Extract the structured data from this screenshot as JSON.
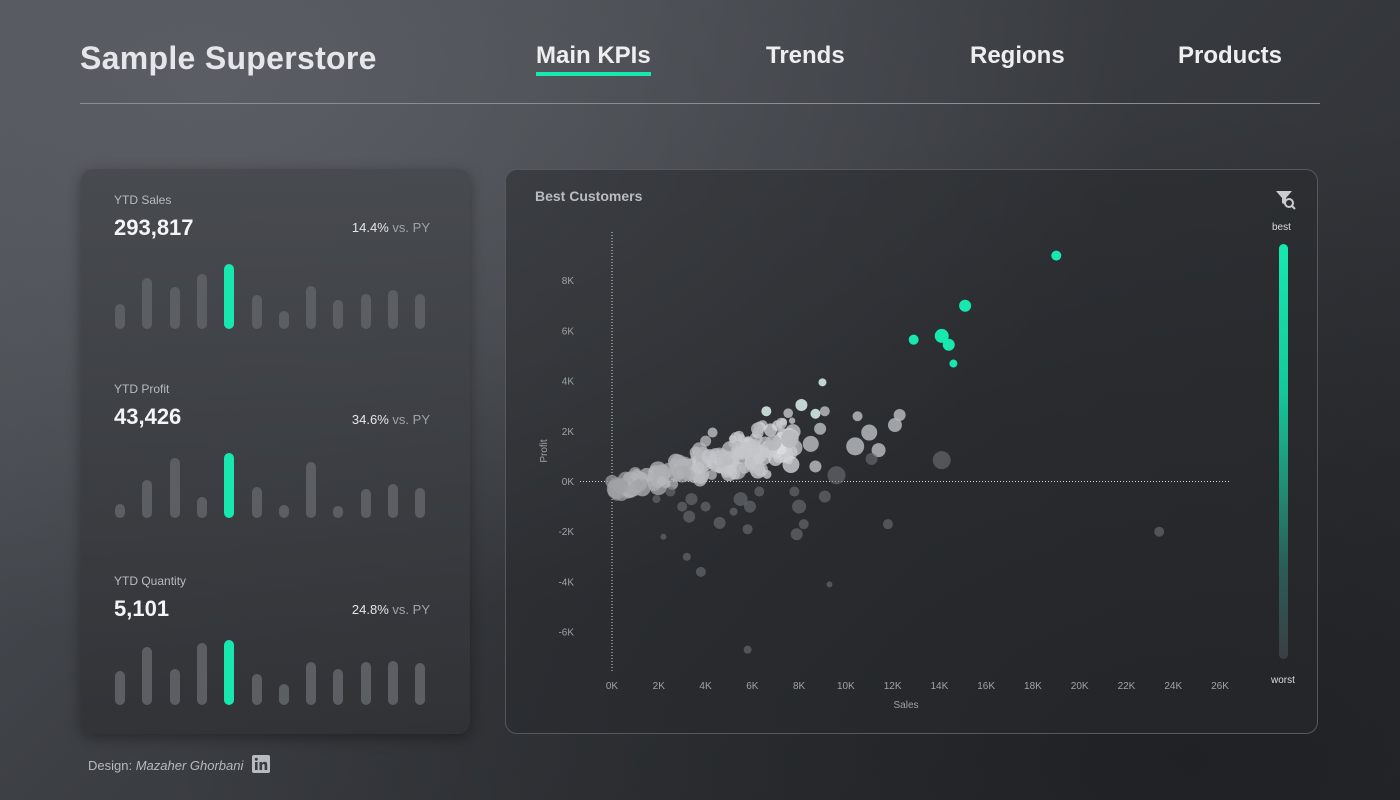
{
  "header": {
    "title": "Sample Superstore",
    "tabs": [
      {
        "label": "Main KPIs",
        "active": true
      },
      {
        "label": "Trends",
        "active": false
      },
      {
        "label": "Regions",
        "active": false
      },
      {
        "label": "Products",
        "active": false
      }
    ]
  },
  "colors": {
    "accent": "#17e8b0",
    "bar": "#5b5e63"
  },
  "kpis": [
    {
      "label": "YTD Sales",
      "value": "293,817",
      "change": "14.4%",
      "vs": "vs. PY",
      "spark": [
        0.38,
        0.78,
        0.65,
        0.85,
        1.0,
        0.52,
        0.28,
        0.66,
        0.45,
        0.54,
        0.6,
        0.54
      ],
      "highlight": 4
    },
    {
      "label": "YTD Profit",
      "value": "43,426",
      "change": "34.6%",
      "vs": "vs. PY",
      "spark": [
        0.22,
        0.58,
        0.92,
        0.33,
        1.0,
        0.48,
        0.2,
        0.86,
        0.16,
        0.44,
        0.52,
        0.46
      ],
      "highlight": 4
    },
    {
      "label": "YTD Quantity",
      "value": "5,101",
      "change": "24.8%",
      "vs": "vs. PY",
      "spark": [
        0.52,
        0.9,
        0.56,
        0.95,
        1.0,
        0.48,
        0.32,
        0.66,
        0.55,
        0.66,
        0.68,
        0.64
      ],
      "highlight": 4
    }
  ],
  "chart": {
    "title": "Best Customers",
    "filter_icon": "filter-search-icon",
    "legend_best": "best",
    "legend_worst": "worst"
  },
  "chart_data": {
    "type": "scatter",
    "title": "Best Customers",
    "xlabel": "Sales",
    "ylabel": "Profit",
    "xlim": [
      0,
      26000
    ],
    "ylim": [
      -7000,
      9000
    ],
    "xticks": [
      "0K",
      "2K",
      "4K",
      "6K",
      "8K",
      "10K",
      "12K",
      "14K",
      "16K",
      "18K",
      "20K",
      "22K",
      "24K",
      "26K"
    ],
    "xtick_values": [
      0,
      2000,
      4000,
      6000,
      8000,
      10000,
      12000,
      14000,
      16000,
      18000,
      20000,
      22000,
      24000,
      26000
    ],
    "yticks": [
      "8K",
      "6K",
      "4K",
      "2K",
      "0K",
      "-2K",
      "-4K",
      "-6K"
    ],
    "ytick_values": [
      8000,
      6000,
      4000,
      2000,
      0,
      -2000,
      -4000,
      -6000
    ],
    "color_legend": {
      "high": "best",
      "low": "worst"
    },
    "points": [
      {
        "x": 19000,
        "y": 9000,
        "r": 5,
        "c": "best"
      },
      {
        "x": 15100,
        "y": 7000,
        "r": 6,
        "c": "best"
      },
      {
        "x": 12900,
        "y": 5650,
        "r": 5,
        "c": "best"
      },
      {
        "x": 14100,
        "y": 5800,
        "r": 7,
        "c": "best"
      },
      {
        "x": 14400,
        "y": 5450,
        "r": 6,
        "c": "best"
      },
      {
        "x": 14600,
        "y": 4700,
        "r": 4,
        "c": "best"
      },
      {
        "x": 9000,
        "y": 3950,
        "r": 4,
        "c": "good"
      },
      {
        "x": 8100,
        "y": 3050,
        "r": 6,
        "c": "good"
      },
      {
        "x": 6600,
        "y": 2800,
        "r": 5,
        "c": "good"
      },
      {
        "x": 8700,
        "y": 2700,
        "r": 5,
        "c": "good"
      },
      {
        "x": 9100,
        "y": 2800,
        "r": 5,
        "c": "mid"
      },
      {
        "x": 12300,
        "y": 2650,
        "r": 6,
        "c": "mid"
      },
      {
        "x": 10500,
        "y": 2600,
        "r": 5,
        "c": "mid"
      },
      {
        "x": 12100,
        "y": 2250,
        "r": 7,
        "c": "mid"
      },
      {
        "x": 11000,
        "y": 1950,
        "r": 8,
        "c": "mid"
      },
      {
        "x": 10400,
        "y": 1400,
        "r": 9,
        "c": "mid"
      },
      {
        "x": 11400,
        "y": 1250,
        "r": 7,
        "c": "mid"
      },
      {
        "x": 11100,
        "y": 900,
        "r": 6,
        "c": "low"
      },
      {
        "x": 14100,
        "y": 850,
        "r": 9,
        "c": "low"
      },
      {
        "x": 9600,
        "y": 250,
        "r": 9,
        "c": "low"
      },
      {
        "x": 8700,
        "y": 600,
        "r": 6,
        "c": "mid"
      },
      {
        "x": 8500,
        "y": 1500,
        "r": 8,
        "c": "mid"
      },
      {
        "x": 7600,
        "y": 1700,
        "r": 9,
        "c": "mid"
      },
      {
        "x": 6900,
        "y": 1550,
        "r": 8,
        "c": "mid"
      },
      {
        "x": 8900,
        "y": 2100,
        "r": 6,
        "c": "mid"
      },
      {
        "x": 4300,
        "y": 1950,
        "r": 5,
        "c": "mid"
      },
      {
        "x": 6200,
        "y": 2100,
        "r": 6,
        "c": "mid"
      },
      {
        "x": 7800,
        "y": -400,
        "r": 5,
        "c": "low"
      },
      {
        "x": 9100,
        "y": -600,
        "r": 6,
        "c": "low"
      },
      {
        "x": 8000,
        "y": -1000,
        "r": 7,
        "c": "low"
      },
      {
        "x": 8200,
        "y": -1700,
        "r": 5,
        "c": "low"
      },
      {
        "x": 7900,
        "y": -2100,
        "r": 6,
        "c": "low"
      },
      {
        "x": 5900,
        "y": -1000,
        "r": 6,
        "c": "low"
      },
      {
        "x": 5500,
        "y": -700,
        "r": 7,
        "c": "low"
      },
      {
        "x": 6300,
        "y": -400,
        "r": 5,
        "c": "low"
      },
      {
        "x": 5800,
        "y": -1900,
        "r": 5,
        "c": "low"
      },
      {
        "x": 4600,
        "y": -1650,
        "r": 6,
        "c": "low"
      },
      {
        "x": 5200,
        "y": -1200,
        "r": 4,
        "c": "low"
      },
      {
        "x": 4000,
        "y": -1000,
        "r": 5,
        "c": "low"
      },
      {
        "x": 3300,
        "y": -1400,
        "r": 6,
        "c": "low"
      },
      {
        "x": 3000,
        "y": -1000,
        "r": 5,
        "c": "low"
      },
      {
        "x": 3400,
        "y": -700,
        "r": 6,
        "c": "low"
      },
      {
        "x": 2500,
        "y": -400,
        "r": 5,
        "c": "low"
      },
      {
        "x": 1900,
        "y": -700,
        "r": 4,
        "c": "low"
      },
      {
        "x": 2200,
        "y": -2200,
        "r": 3,
        "c": "low"
      },
      {
        "x": 3200,
        "y": -3000,
        "r": 4,
        "c": "low"
      },
      {
        "x": 3800,
        "y": -3600,
        "r": 5,
        "c": "low"
      },
      {
        "x": 9300,
        "y": -4100,
        "r": 3,
        "c": "low"
      },
      {
        "x": 5800,
        "y": -6700,
        "r": 4,
        "c": "low"
      },
      {
        "x": 23400,
        "y": -2000,
        "r": 5,
        "c": "low"
      },
      {
        "x": 11800,
        "y": -1700,
        "r": 5,
        "c": "low"
      }
    ]
  },
  "footer": {
    "design_label": "Design:",
    "designer": "Mazaher Ghorbani",
    "link_icon": "linkedin-icon"
  }
}
